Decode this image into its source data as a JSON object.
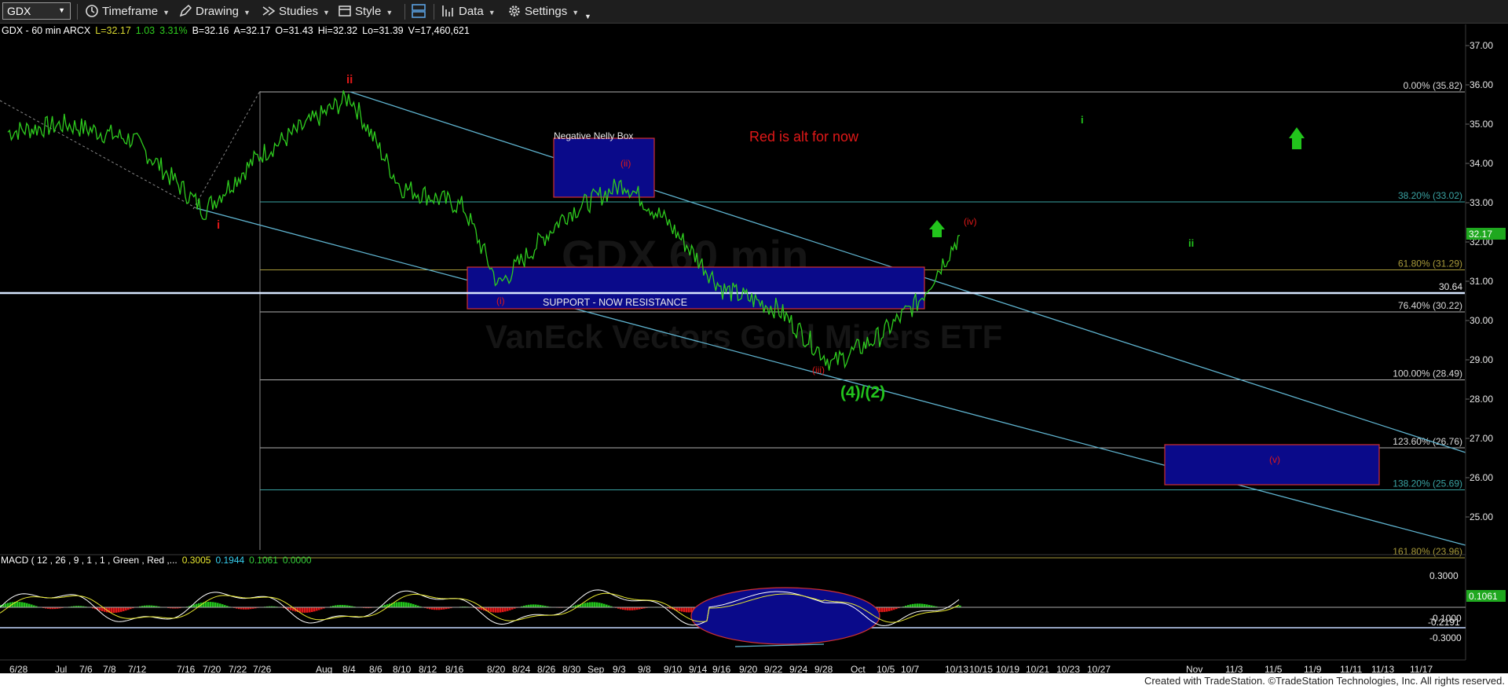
{
  "toolbar": {
    "symbol": "GDX",
    "timeframe": "Timeframe",
    "drawing": "Drawing",
    "studies": "Studies",
    "style": "Style",
    "data": "Data",
    "settings": "Settings",
    "icons": [
      "clock-icon",
      "pencil-icon",
      "studies-icon",
      "style-icon",
      "layout-icon",
      "bars-icon",
      "gear-icon"
    ]
  },
  "header": {
    "name": "GDX - 60 min ARCX",
    "last": "L=32.17",
    "change": "1.03",
    "pct": "3.31%",
    "bid": "B=32.16",
    "ask": "A=32.17",
    "open": "O=31.43",
    "hi": "Hi=32.32",
    "lo": "Lo=31.39",
    "vol": "V=17,460,621"
  },
  "watermark": {
    "symbol": "GDX 60 min",
    "name": "VanEck Vectors Gold Miners ETF"
  },
  "price_axis": {
    "ticks": [
      "37.00",
      "36.00",
      "35.00",
      "34.00",
      "33.00",
      "32.00",
      "31.00",
      "30.00",
      "29.00",
      "28.00",
      "27.00",
      "26.00",
      "25.00"
    ],
    "last_badge": "32.17",
    "line_badge": "30.64"
  },
  "annotations": {
    "negative_nelly": "Negative Nelly Box",
    "red_alt": "Red is alt for now",
    "support": "SUPPORT -  NOW RESISTANCE",
    "wave_4_2": "(4)/(2)",
    "wave_ii_red": "ii",
    "wave_i_red": "i",
    "wave_i_paren": "(i)",
    "wave_ii_paren": "(ii)",
    "wave_iii_paren": "(iii)",
    "wave_iv_paren": "(iv)",
    "wave_v_paren": "(v)",
    "wave_i_green": "i",
    "wave_ii_green": "ii"
  },
  "fib_levels": [
    {
      "label": "0.00% (35.82)",
      "value": 35.82,
      "color": "#b0b0b0"
    },
    {
      "label": "38.20% (33.02)",
      "value": 33.02,
      "color": "#3aa3a3"
    },
    {
      "label": "61.80% (31.29)",
      "value": 31.29,
      "color": "#a89a3a"
    },
    {
      "label": "76.40% (30.22)",
      "value": 30.22,
      "color": "#b0b0b0"
    },
    {
      "label": "100.00% (28.49)",
      "value": 28.49,
      "color": "#b0b0b0"
    },
    {
      "label": "123.60% (26.76)",
      "value": 26.76,
      "color": "#b0b0b0"
    },
    {
      "label": "138.20% (25.69)",
      "value": 25.69,
      "color": "#3aa3a3"
    },
    {
      "label": "161.80% (23.96)",
      "value": 23.96,
      "color": "#a89a3a"
    }
  ],
  "macd": {
    "label": "MACD ( 12 , 26 , 9 , 1 , 1 , Green , Red ,...",
    "v1": "0.3005",
    "v2": "0.1944",
    "v3": "0.1061",
    "v4": "0.0000",
    "ticks": [
      "0.3000",
      "-0.1000",
      "-0.3000"
    ],
    "badge_value": "0.1061",
    "level_label": "-0.2191"
  },
  "x_axis": [
    "6/28",
    "Jul",
    "7/6",
    "7/8",
    "7/12",
    "7/16",
    "7/20",
    "7/22",
    "7/26",
    "Aug",
    "8/4",
    "8/6",
    "8/10",
    "8/12",
    "8/16",
    "8/20",
    "8/24",
    "8/26",
    "8/30",
    "Sep",
    "9/3",
    "9/8",
    "9/10",
    "9/14",
    "9/16",
    "9/20",
    "9/22",
    "9/24",
    "9/28",
    "Oct",
    "10/5",
    "10/7",
    "10/13",
    "10/15",
    "10/19",
    "10/21",
    "10/23",
    "10/27",
    "Nov",
    "11/3",
    "11/5",
    "11/9",
    "11/11",
    "11/13",
    "11/17"
  ],
  "footer": "Created with TradeStation. ©TradeStation Technologies, Inc. All rights reserved.",
  "colors": {
    "price": "#2ecc1e",
    "wave_red": "#e01818",
    "wave_green": "#22c41c",
    "channel": "#5fb3cf",
    "box_fill": "#0a0a8a",
    "box_border": "#d03030"
  },
  "chart_data": {
    "type": "line",
    "title": "GDX - 60 min ARCX",
    "ylim": [
      23.9,
      37.4
    ],
    "x": [
      "6/28",
      "7/6",
      "7/12",
      "7/20",
      "7/26",
      "8/4",
      "8/10",
      "8/16",
      "8/20",
      "8/26",
      "9/3",
      "9/10",
      "9/16",
      "9/20",
      "9/28",
      "10/5",
      "10/7",
      "10/13"
    ],
    "series": [
      {
        "values": [
          34.8,
          35.0,
          34.6,
          32.8,
          34.2,
          35.7,
          33.4,
          32.9,
          30.9,
          32.7,
          33.5,
          32.5,
          30.8,
          30.3,
          28.9,
          29.6,
          30.5,
          32.17
        ]
      }
    ]
  }
}
